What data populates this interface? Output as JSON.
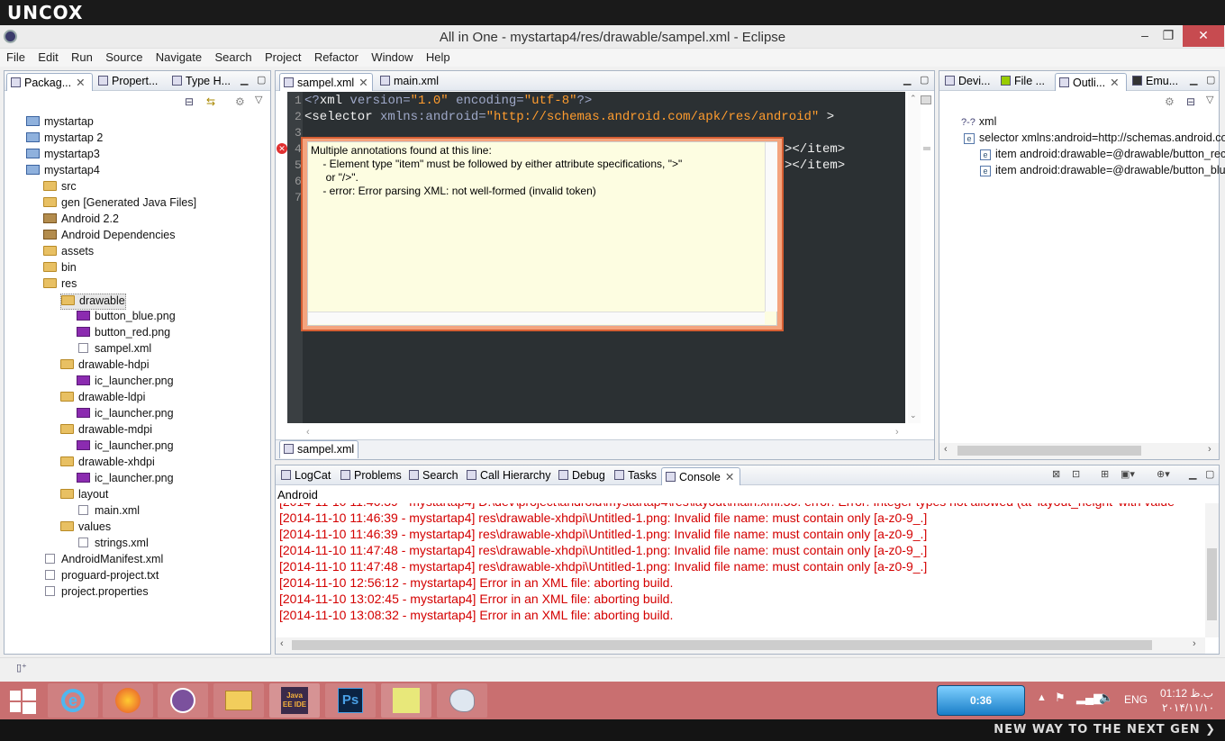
{
  "brand": "UNCOX",
  "window": {
    "title": "All in One - mystartap4/res/drawable/sampel.xml - Eclipse",
    "min": "–",
    "max": "❐",
    "close": "✕"
  },
  "menu": [
    "File",
    "Edit",
    "Run",
    "Source",
    "Navigate",
    "Search",
    "Project",
    "Refactor",
    "Window",
    "Help"
  ],
  "left_tabs": [
    "Packag...",
    "Propert...",
    "Type H..."
  ],
  "tree": [
    {
      "label": "mystartap",
      "type": "proj",
      "indent": 0
    },
    {
      "label": "mystartap 2",
      "type": "proj",
      "indent": 0
    },
    {
      "label": "mystartap3",
      "type": "proj",
      "indent": 0
    },
    {
      "label": "mystartap4",
      "type": "proj",
      "indent": 0
    },
    {
      "label": "src",
      "type": "folder",
      "indent": 1
    },
    {
      "label": "gen [Generated Java Files]",
      "type": "folder",
      "indent": 1
    },
    {
      "label": "Android 2.2",
      "type": "lib",
      "indent": 1
    },
    {
      "label": "Android Dependencies",
      "type": "lib",
      "indent": 1
    },
    {
      "label": "assets",
      "type": "folder",
      "indent": 1
    },
    {
      "label": "bin",
      "type": "folder",
      "indent": 1
    },
    {
      "label": "res",
      "type": "folder",
      "indent": 1
    },
    {
      "label": "drawable",
      "type": "folder",
      "indent": 2,
      "selected": true
    },
    {
      "label": "button_blue.png",
      "type": "png",
      "indent": 3
    },
    {
      "label": "button_red.png",
      "type": "png",
      "indent": 3
    },
    {
      "label": "sampel.xml",
      "type": "xmlf",
      "indent": 3
    },
    {
      "label": "drawable-hdpi",
      "type": "folder",
      "indent": 2
    },
    {
      "label": "ic_launcher.png",
      "type": "png",
      "indent": 3
    },
    {
      "label": "drawable-ldpi",
      "type": "folder",
      "indent": 2
    },
    {
      "label": "ic_launcher.png",
      "type": "png",
      "indent": 3
    },
    {
      "label": "drawable-mdpi",
      "type": "folder",
      "indent": 2
    },
    {
      "label": "ic_launcher.png",
      "type": "png",
      "indent": 3
    },
    {
      "label": "drawable-xhdpi",
      "type": "folder",
      "indent": 2
    },
    {
      "label": "ic_launcher.png",
      "type": "png",
      "indent": 3
    },
    {
      "label": "layout",
      "type": "folder",
      "indent": 2
    },
    {
      "label": "main.xml",
      "type": "xmlf",
      "indent": 3
    },
    {
      "label": "values",
      "type": "folder",
      "indent": 2
    },
    {
      "label": "strings.xml",
      "type": "xmlf",
      "indent": 3
    },
    {
      "label": "AndroidManifest.xml",
      "type": "xmlf",
      "indent": 1
    },
    {
      "label": "proguard-project.txt",
      "type": "xmlf",
      "indent": 1
    },
    {
      "label": "project.properties",
      "type": "xmlf",
      "indent": 1
    }
  ],
  "editor_tabs": [
    "sampel.xml",
    "main.xml"
  ],
  "editor_bottom_tab": "sampel.xml",
  "code": {
    "line_numbers": [
      "1",
      "2",
      "3",
      "4",
      "5",
      "6",
      "7"
    ],
    "l1": {
      "open": "<?",
      "tag": "xml",
      "a1": " version",
      "eq1": "=",
      "v1": "\"1.0\"",
      "a2": " encoding",
      "eq2": "=",
      "v2": "\"utf-8\"",
      "close": "?>"
    },
    "l2": {
      "tag": "<selector",
      "attr": " xmlns:android",
      "eq": "=",
      "val": "\"http://schemas.android.com/apk/res/android\"",
      "close": " >"
    },
    "l4_tail": "></item>",
    "l5_tail": "></item>"
  },
  "popup": {
    "lines": [
      "Multiple annotations found at this line:",
      "    - Element type \"item\" must be followed by either attribute specifications, \">\"",
      "     or \"/>\".",
      "    - error: Error parsing XML: not well-formed (invalid token)"
    ]
  },
  "right_tabs": [
    "Devi...",
    "File ...",
    "Outli...",
    "Emu..."
  ],
  "outline": [
    {
      "label": "xml",
      "icon": "?-?"
    },
    {
      "label": "selector xmlns:android=http://schemas.android.co",
      "icon": "e"
    },
    {
      "label": "item android:drawable=@drawable/button_rec",
      "icon": "e"
    },
    {
      "label": "item android:drawable=@drawable/button_blu",
      "icon": "e"
    }
  ],
  "bottom_tabs": [
    "LogCat",
    "Problems",
    "Search",
    "Call Hierarchy",
    "Debug",
    "Tasks",
    "Console"
  ],
  "console_title": "Android",
  "console_lines": [
    "[2014-11-10 11:46:39 - mystartap4] res\\drawable-xhdpi\\Untitled-1.png: Invalid file name: must contain only [a-z0-9_.]",
    "[2014-11-10 11:46:39 - mystartap4] res\\drawable-xhdpi\\Untitled-1.png: Invalid file name: must contain only [a-z0-9_.]",
    "[2014-11-10 11:47:48 - mystartap4] res\\drawable-xhdpi\\Untitled-1.png: Invalid file name: must contain only [a-z0-9_.]",
    "[2014-11-10 11:47:48 - mystartap4] res\\drawable-xhdpi\\Untitled-1.png: Invalid file name: must contain only [a-z0-9_.]",
    "[2014-11-10 12:56:12 - mystartap4] Error in an XML file: aborting build.",
    "[2014-11-10 13:02:45 - mystartap4] Error in an XML file: aborting build.",
    "[2014-11-10 13:08:32 - mystartap4] Error in an XML file: aborting build."
  ],
  "taskbar": {
    "apps": [
      "start-button",
      "ie",
      "firefox",
      "viber",
      "explorer",
      "javaee-ide",
      "photoshop",
      "media",
      "paint"
    ],
    "javaee_label": "Java EE IDE",
    "ps_label": "Ps",
    "battery": "0:36",
    "lang": "ENG",
    "time": "01:12 ب.ظ",
    "date": "۲۰۱۴/۱۱/۱۰"
  },
  "slogan": "NEW WAY TO THE NEXT GEN ❯"
}
